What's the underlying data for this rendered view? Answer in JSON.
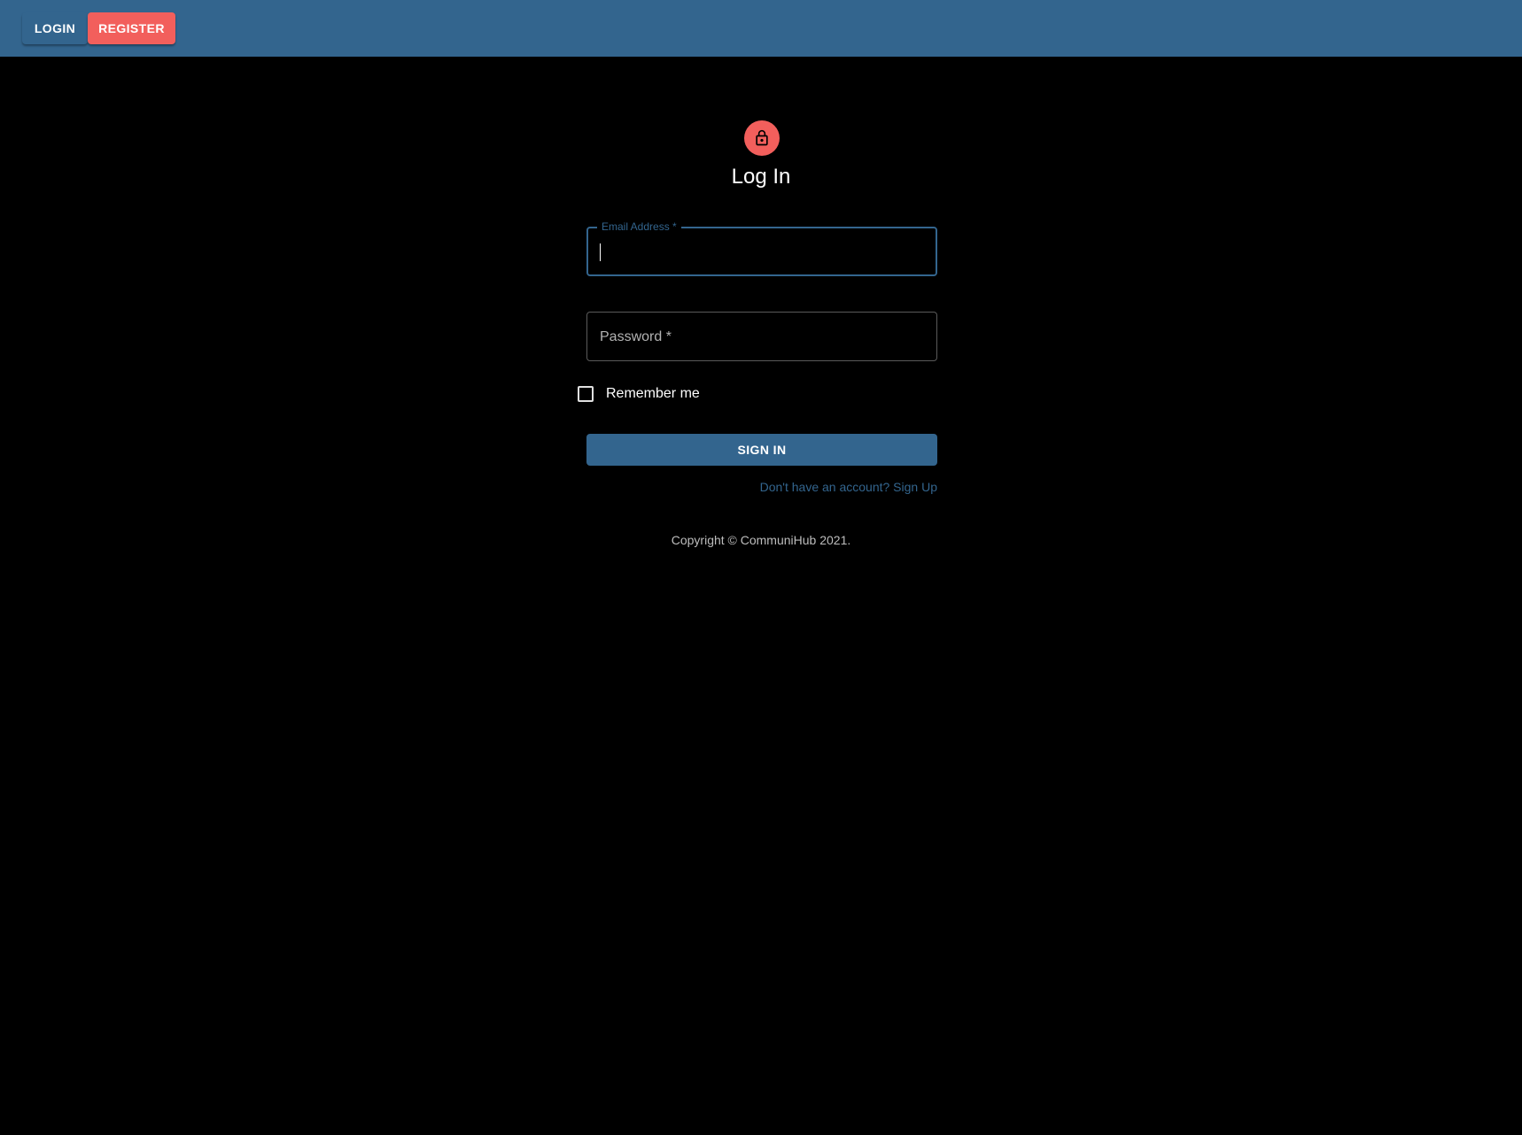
{
  "header": {
    "login_label": "LOGIN",
    "register_label": "REGISTER"
  },
  "main": {
    "avatar_icon": "lock-icon",
    "title": "Log In",
    "email": {
      "label": "Email Address *",
      "value": ""
    },
    "password": {
      "label": "Password *",
      "value": ""
    },
    "remember_label": "Remember me",
    "remember_checked": false,
    "signin_label": "SIGN IN",
    "signup_link": "Don't have an account? Sign Up",
    "copyright": "Copyright © CommuniHub 2021."
  },
  "colors": {
    "primary": "#33658e",
    "secondary": "#f25f5c",
    "background": "#000000"
  }
}
